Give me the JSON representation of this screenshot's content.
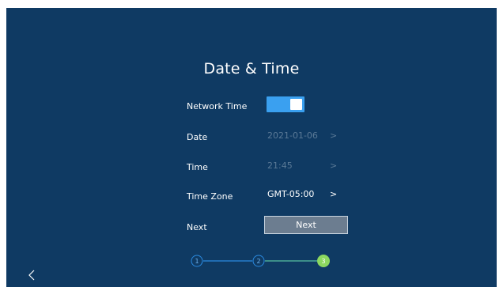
{
  "title": "Date & Time",
  "rows": {
    "network_time": {
      "label": "Network Time",
      "enabled": true
    },
    "date": {
      "label": "Date",
      "value": "2021-01-06",
      "chevron": ">"
    },
    "time": {
      "label": "Time",
      "value": "21:45",
      "chevron": ">"
    },
    "time_zone": {
      "label": "Time Zone",
      "value": "GMT-05:00",
      "chevron": ">"
    },
    "next": {
      "label": "Next",
      "button_label": "Next"
    }
  },
  "steps": [
    {
      "number": "1",
      "state": "done"
    },
    {
      "number": "2",
      "state": "done"
    },
    {
      "number": "3",
      "state": "current"
    }
  ],
  "colors": {
    "background": "#0f3a63",
    "accent": "#3aa0f0",
    "current_step": "#8cd860",
    "disabled_text": "#5a7996"
  }
}
